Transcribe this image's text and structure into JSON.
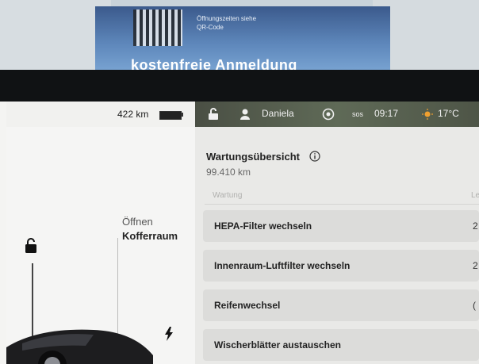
{
  "poster": {
    "note": "Öffnungszeiten siehe QR-Code",
    "headline": "kostenfreie Anmeldung"
  },
  "status_bar": {
    "range": "422 km",
    "driver": "Daniela",
    "sos": "sos",
    "time": "09:17",
    "temperature": "17°C"
  },
  "left_panel": {
    "trunk_action": "Öffnen",
    "trunk_label": "Kofferraum"
  },
  "maintenance": {
    "title": "Wartungsübersicht",
    "odometer": "99.410 km",
    "column_headers": [
      "Wartung",
      "Le"
    ],
    "rows": [
      {
        "label": "HEPA-Filter wechseln",
        "value": "2"
      },
      {
        "label": "Innenraum-Luftfilter wechseln",
        "value": "2"
      },
      {
        "label": "Reifenwechsel",
        "value": "("
      },
      {
        "label": "Wischerblätter austauschen",
        "value": ""
      }
    ]
  },
  "colors": {
    "accent_orange": "#f0a030",
    "status_bar": "#525a4e"
  }
}
